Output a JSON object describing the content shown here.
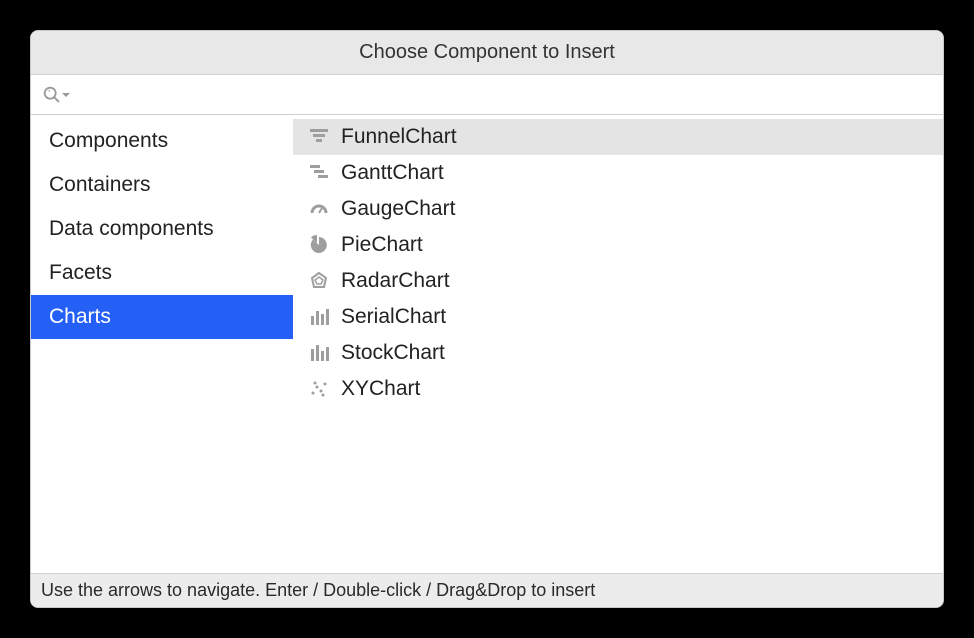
{
  "window": {
    "title": "Choose Component to Insert"
  },
  "search": {
    "placeholder": "",
    "value": ""
  },
  "sidebar": {
    "items": [
      {
        "label": "Components",
        "selected": false
      },
      {
        "label": "Containers",
        "selected": false
      },
      {
        "label": "Data components",
        "selected": false
      },
      {
        "label": "Facets",
        "selected": false
      },
      {
        "label": "Charts",
        "selected": true
      }
    ]
  },
  "list": {
    "items": [
      {
        "label": "FunnelChart",
        "icon": "funnel-icon",
        "selected": true
      },
      {
        "label": "GanttChart",
        "icon": "gantt-icon",
        "selected": false
      },
      {
        "label": "GaugeChart",
        "icon": "gauge-icon",
        "selected": false
      },
      {
        "label": "PieChart",
        "icon": "pie-icon",
        "selected": false
      },
      {
        "label": "RadarChart",
        "icon": "radar-icon",
        "selected": false
      },
      {
        "label": "SerialChart",
        "icon": "serial-icon",
        "selected": false
      },
      {
        "label": "StockChart",
        "icon": "stock-icon",
        "selected": false
      },
      {
        "label": "XYChart",
        "icon": "xy-icon",
        "selected": false
      }
    ]
  },
  "statusbar": {
    "text": "Use the arrows to navigate.  Enter / Double-click / Drag&Drop to insert"
  }
}
